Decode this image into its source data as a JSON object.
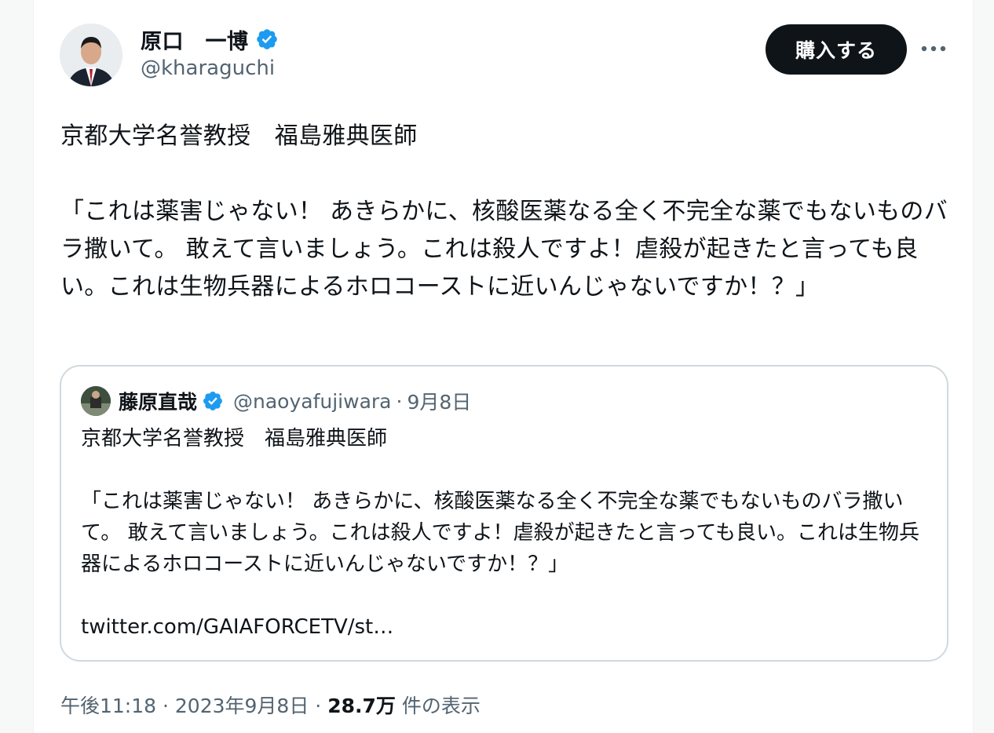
{
  "author": {
    "display_name": "原口　一博",
    "handle": "@kharaguchi"
  },
  "actions": {
    "buy_label": "購入する",
    "more_icon": "more-horizontal-icon"
  },
  "tweet": {
    "text": "京都大学名誉教授　福島雅典医師\n\n「これは薬害じゃない！ あきらかに、核酸医薬なる全く不完全な薬でもないものバラ撒いて。 敢えて言いましょう。これは殺人ですよ！虐殺が起きたと言っても良い。これは生物兵器によるホロコーストに近いんじゃないですか！？」"
  },
  "quote": {
    "display_name": "藤原直哉",
    "handle": "@naoyafujiwara",
    "separator": "·",
    "date": "9月8日",
    "text": "京都大学名誉教授　福島雅典医師\n\n「これは薬害じゃない！ あきらかに、核酸医薬なる全く不完全な薬でもないものバラ撒いて。 敢えて言いましょう。これは殺人ですよ！虐殺が起きたと言っても良い。これは生物兵器によるホロコーストに近いんじゃないですか！？」\n\ntwitter.com/GAIAFORCETV/st…"
  },
  "footer": {
    "time": "午後11:18",
    "separator": "·",
    "date": "2023年9月8日",
    "views_count": "28.7万",
    "views_label": "件の表示"
  },
  "colors": {
    "verified_badge": "#1d9bf0",
    "secondary_text": "#536471",
    "button_bg": "#0f1419",
    "border": "#cfd9de"
  }
}
